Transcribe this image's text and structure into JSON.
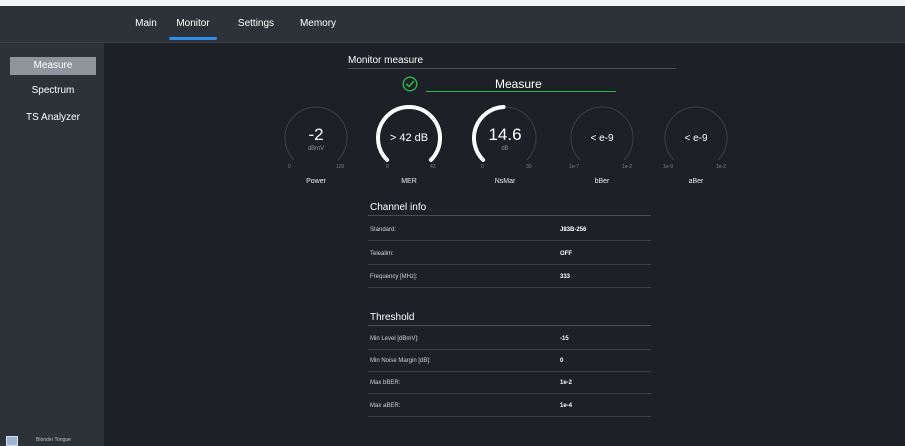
{
  "nav": {
    "tabs": [
      {
        "label": "Main"
      },
      {
        "label": "Monitor"
      },
      {
        "label": "Settings"
      },
      {
        "label": "Memory"
      }
    ],
    "active_tab": "Monitor"
  },
  "sidebar": {
    "items": [
      {
        "label": "Measure"
      },
      {
        "label": "Spectrum"
      },
      {
        "label": "TS Analyzer"
      }
    ],
    "active_item": "Measure",
    "logo_text": "Blonder Tongue"
  },
  "monitor": {
    "title": "Monitor measure",
    "status_icon": "check-circle-icon",
    "status_color": "#2eb84a",
    "measure_label": "Measure"
  },
  "gauges": [
    {
      "label": "Power",
      "value": "-2",
      "unit": "dBmV",
      "min": "0",
      "max": "120",
      "level": 0
    },
    {
      "label": "MER",
      "value": "> 42 dB",
      "unit": "",
      "min": "0",
      "max": "42",
      "level": 1
    },
    {
      "label": "NsMar",
      "value": "14.6",
      "unit": "dB",
      "min": "0",
      "max": "30",
      "level": 0.49
    },
    {
      "label": "bBer",
      "value": "< e-9",
      "unit": "",
      "min": "1e-7",
      "max": "1e-2",
      "level": 0
    },
    {
      "label": "aBer",
      "value": "< e-9",
      "unit": "",
      "min": "1e-9",
      "max": "1e-2",
      "level": 0
    }
  ],
  "channel_info": {
    "title": "Channel info",
    "rows": [
      {
        "label": "Standard:",
        "value": "J83B-256"
      },
      {
        "label": "Telealim:",
        "value": "OFF"
      },
      {
        "label": "Frequency [MHz]:",
        "value": "333"
      }
    ]
  },
  "threshold": {
    "title": "Threshold",
    "rows": [
      {
        "label": "Min Level [dBmV]:",
        "value": "-15"
      },
      {
        "label": "Min Noise Margin [dB]:",
        "value": "0"
      },
      {
        "label": "Max bBER:",
        "value": "1e-2"
      },
      {
        "label": "Max aBER:",
        "value": "1e-4"
      }
    ]
  }
}
